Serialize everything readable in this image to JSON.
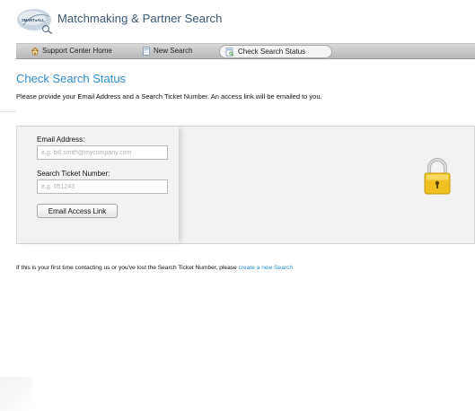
{
  "header": {
    "logo_badge_text": "SMART●ALL",
    "brand_title": "Matchmaking & Partner Search"
  },
  "nav": {
    "items": [
      {
        "label": "Support Center Home",
        "icon": "home-icon"
      },
      {
        "label": "New Search",
        "icon": "new-document-icon"
      },
      {
        "label": "Check Search Status",
        "icon": "search-document-icon",
        "active": true
      }
    ]
  },
  "page": {
    "title": "Check Search Status",
    "intro": "Please provide your Email Address and a Search Ticket Number. An access link will be emailed to you."
  },
  "form": {
    "email_label": "Email Address:",
    "email_placeholder": "e.g. bill.smith@mycompany.com",
    "ticket_label": "Search Ticket Number:",
    "ticket_placeholder": "e.g. 051243",
    "submit_label": "Email Access Link"
  },
  "footer": {
    "text": "If this is your first time contacting us or you've lost the Search Ticket Number, please ",
    "link_text": "create a new Search"
  },
  "colors": {
    "accent": "#2b8fd3",
    "brand_text": "#3a5673",
    "lock_gold": "#f0c020"
  }
}
